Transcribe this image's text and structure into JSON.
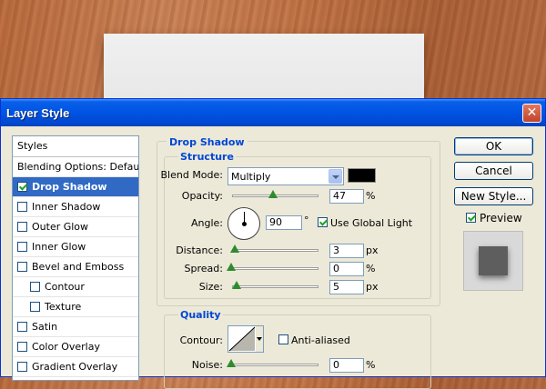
{
  "window": {
    "title": "Layer Style",
    "close_symbol": "✕"
  },
  "styles_list": {
    "header": "Styles",
    "items": [
      {
        "label": "Blending Options: Default",
        "checkbox": false
      },
      {
        "label": "Drop Shadow",
        "checkbox": true,
        "checked": true,
        "selected": true
      },
      {
        "label": "Inner Shadow",
        "checkbox": true,
        "checked": false
      },
      {
        "label": "Outer Glow",
        "checkbox": true,
        "checked": false
      },
      {
        "label": "Inner Glow",
        "checkbox": true,
        "checked": false
      },
      {
        "label": "Bevel and Emboss",
        "checkbox": true,
        "checked": false
      },
      {
        "label": "Contour",
        "checkbox": true,
        "checked": false,
        "indent": true
      },
      {
        "label": "Texture",
        "checkbox": true,
        "checked": false,
        "indent": true
      },
      {
        "label": "Satin",
        "checkbox": true,
        "checked": false
      },
      {
        "label": "Color Overlay",
        "checkbox": true,
        "checked": false
      },
      {
        "label": "Gradient Overlay",
        "checkbox": true,
        "checked": false
      }
    ]
  },
  "drop_shadow": {
    "title": "Drop Shadow",
    "structure": {
      "title": "Structure",
      "blend_mode_label": "Blend Mode:",
      "blend_mode_value": "Multiply",
      "shadow_color": "#000000",
      "opacity_label": "Opacity:",
      "opacity_value": "47",
      "opacity_unit": "%",
      "angle_label": "Angle:",
      "angle_value": "90",
      "angle_unit": "°",
      "use_global_light_label": "Use Global Light",
      "use_global_light_checked": true,
      "distance_label": "Distance:",
      "distance_value": "3",
      "distance_unit": "px",
      "spread_label": "Spread:",
      "spread_value": "0",
      "spread_unit": "%",
      "size_label": "Size:",
      "size_value": "5",
      "size_unit": "px"
    },
    "quality": {
      "title": "Quality",
      "contour_label": "Contour:",
      "anti_aliased_label": "Anti-aliased",
      "anti_aliased_checked": false,
      "noise_label": "Noise:",
      "noise_value": "0",
      "noise_unit": "%"
    }
  },
  "buttons": {
    "ok": "OK",
    "cancel": "Cancel",
    "new_style": "New Style...",
    "preview_label": "Preview",
    "preview_checked": true
  },
  "colors": {
    "titlebar": "#0054e3",
    "selection": "#316ac5",
    "section_title": "#0046d5",
    "slider_thumb": "#2e8b2e"
  }
}
